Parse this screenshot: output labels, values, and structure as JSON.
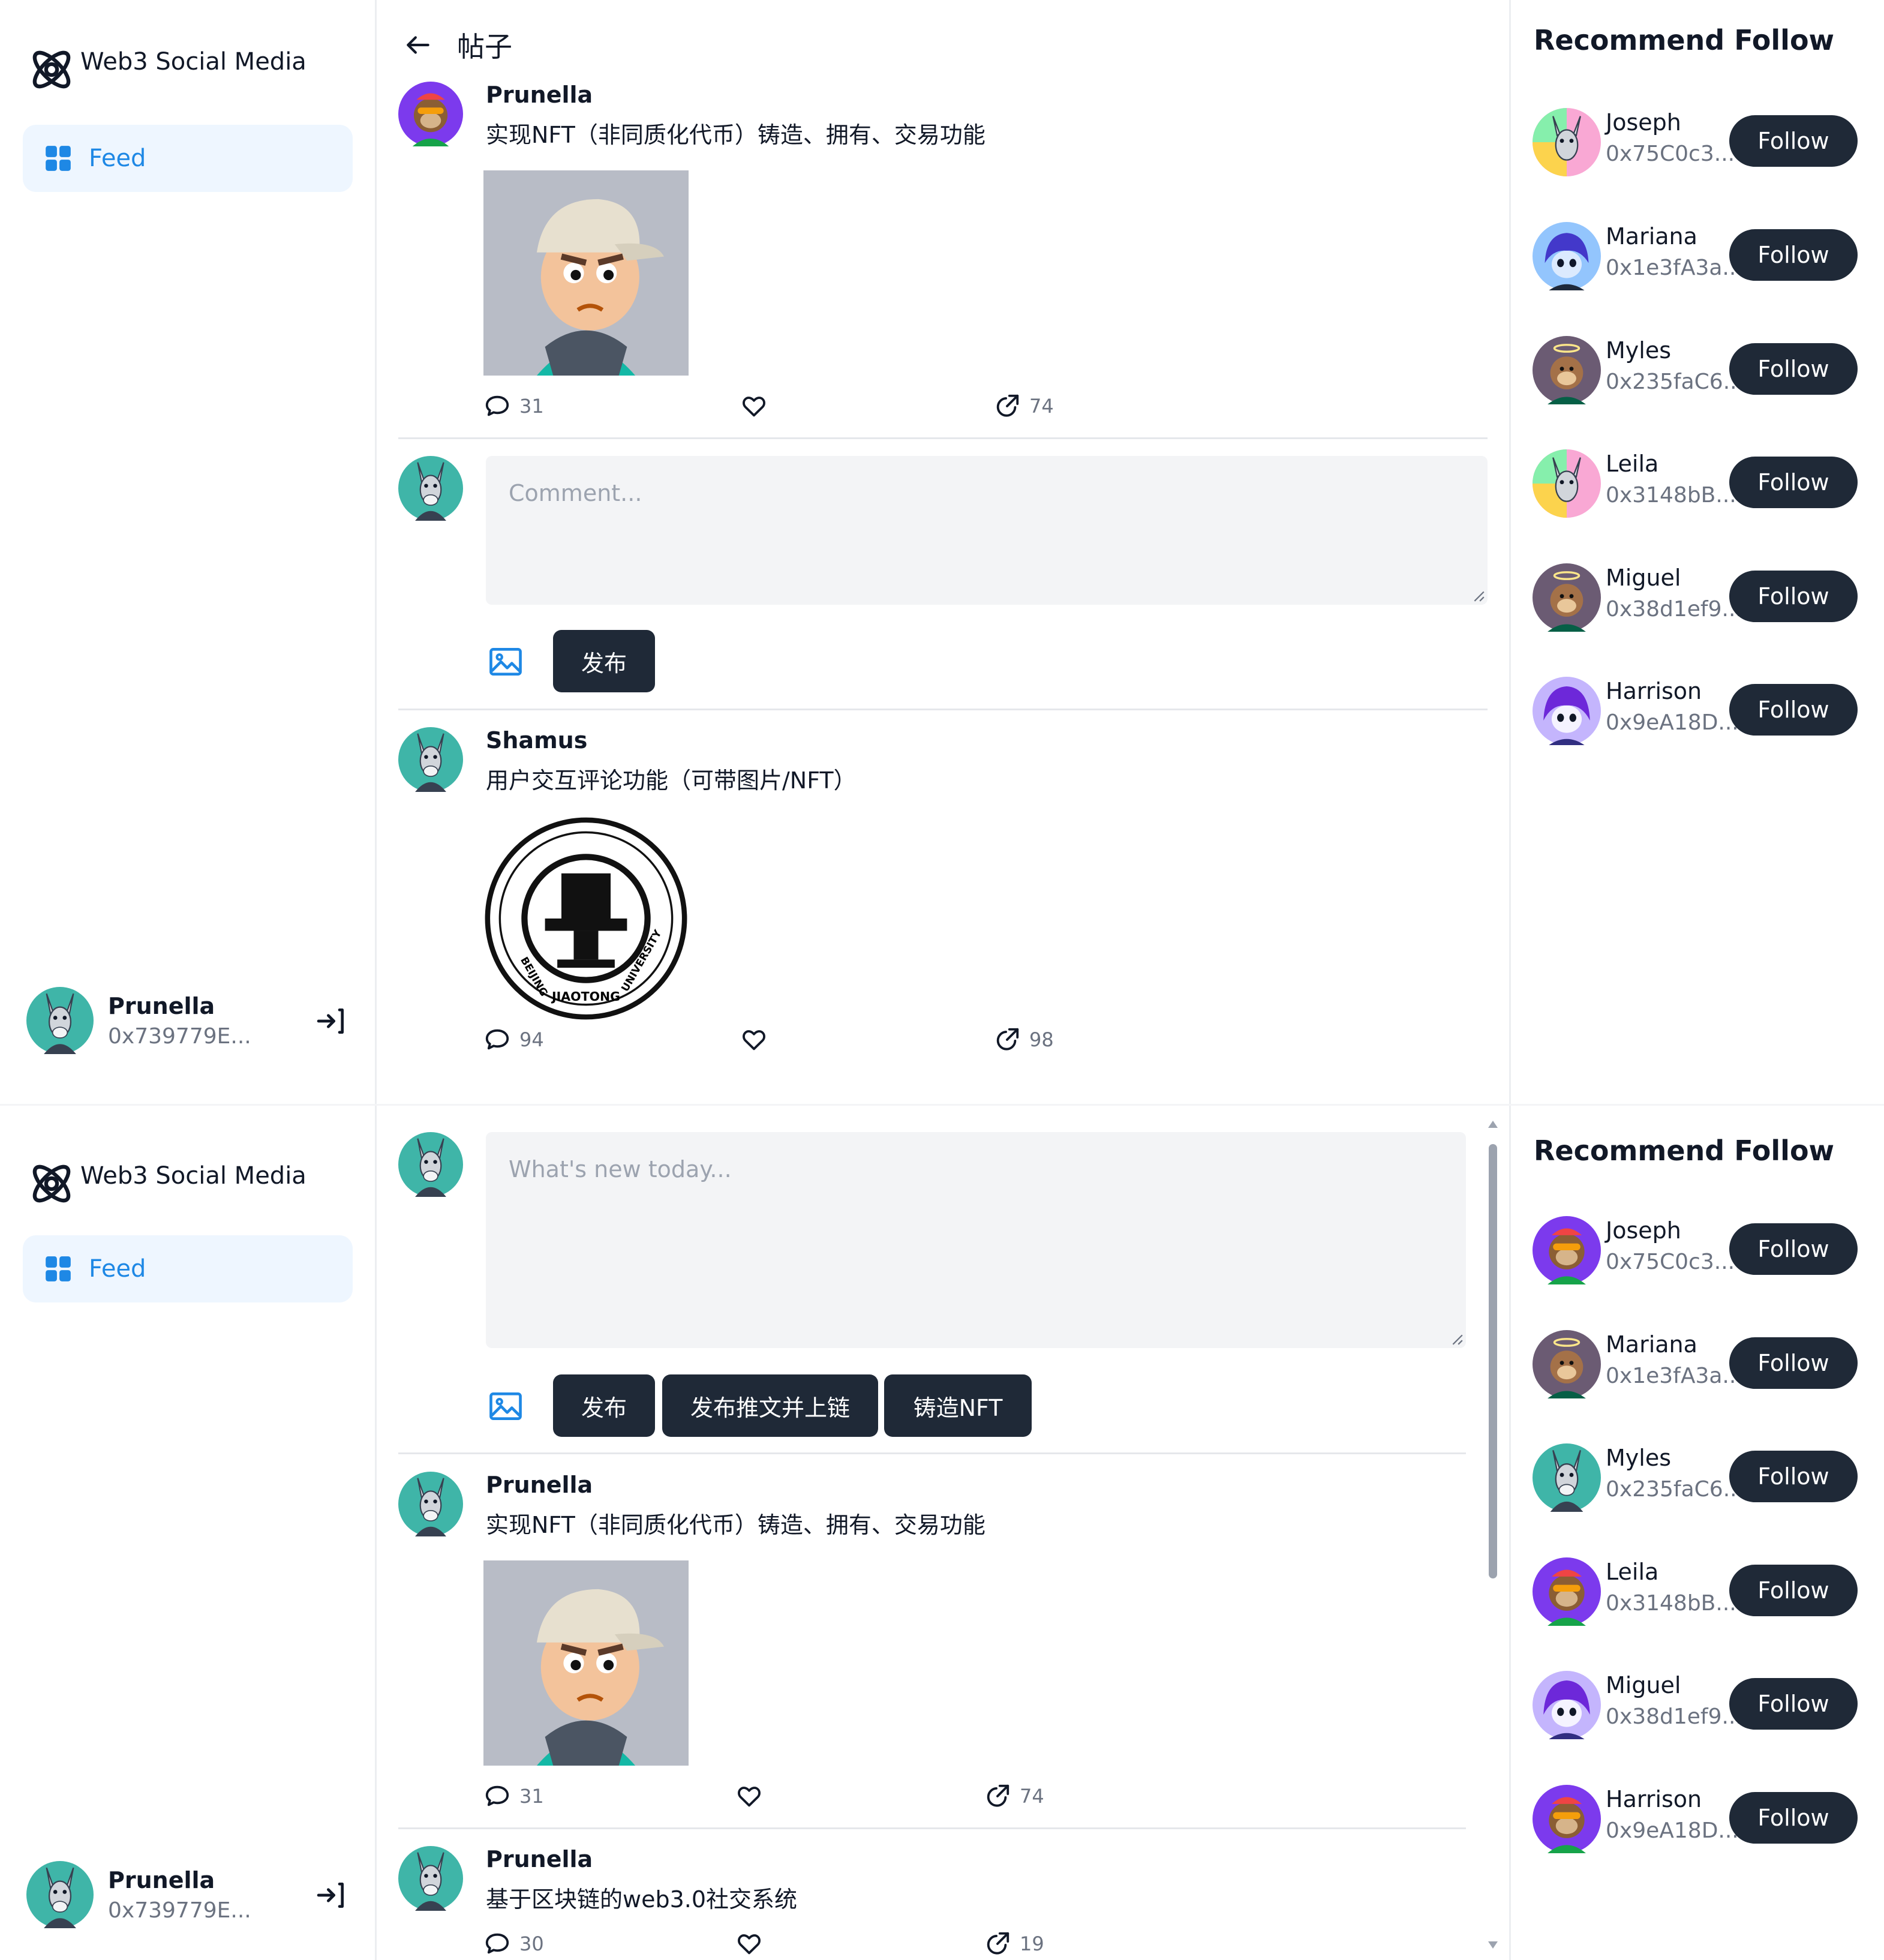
{
  "app": {
    "name": "Web3 Social Media"
  },
  "nav": {
    "feed_label": "Feed"
  },
  "me": {
    "name": "Prunella",
    "address": "0x739779E..."
  },
  "top": {
    "page_title": "帖子",
    "post": {
      "author": "Prunella",
      "content": "实现NFT（非同质化代币）铸造、拥有、交易功能",
      "comments": "31",
      "shares": "74"
    },
    "comment_box": {
      "placeholder": "Comment...",
      "submit_label": "发布"
    },
    "reply": {
      "author": "Shamus",
      "content": "用户交互评论功能（可带图片/NFT）",
      "comments": "94",
      "shares": "98"
    },
    "seal": {
      "text_bottom": "JIAOTONG",
      "text_left": "BEIJING",
      "text_right": "UNIVERSITY"
    }
  },
  "bottom": {
    "composer": {
      "placeholder": "What's new today...",
      "publish_label": "发布",
      "publish_chain_label": "发布推文并上链",
      "mint_label": "铸造NFT"
    },
    "posts": [
      {
        "author": "Prunella",
        "content": "实现NFT（非同质化代币）铸造、拥有、交易功能",
        "comments": "31",
        "shares": "74"
      },
      {
        "author": "Prunella",
        "content": "基于区块链的web3.0社交系统",
        "comments": "30",
        "shares": "19"
      }
    ]
  },
  "recommend": {
    "heading": "Recommend Follow",
    "follow_label": "Follow",
    "top": [
      {
        "name": "Joseph",
        "address": "0x75C0c3..."
      },
      {
        "name": "Mariana",
        "address": "0x1e3fA3a..."
      },
      {
        "name": "Myles",
        "address": "0x235faC6..."
      },
      {
        "name": "Leila",
        "address": "0x3148bB..."
      },
      {
        "name": "Miguel",
        "address": "0x38d1ef9..."
      },
      {
        "name": "Harrison",
        "address": "0x9eA18D..."
      }
    ],
    "bottom": [
      {
        "name": "Joseph",
        "address": "0x75C0c3..."
      },
      {
        "name": "Mariana",
        "address": "0x1e3fA3a..."
      },
      {
        "name": "Myles",
        "address": "0x235faC6..."
      },
      {
        "name": "Leila",
        "address": "0x3148bB..."
      },
      {
        "name": "Miguel",
        "address": "0x38d1ef9..."
      },
      {
        "name": "Harrison",
        "address": "0x9eA18D..."
      }
    ]
  },
  "colors": {
    "accent": "#1e88e5",
    "nav_active_bg": "#eef6ff",
    "button_dark": "#1f2937",
    "muted_text": "#6b7280"
  },
  "icons": [
    "atom-logo-icon",
    "grid-icon",
    "logout-icon",
    "back-arrow-icon",
    "comment-icon",
    "heart-icon",
    "share-icon",
    "image-icon"
  ]
}
